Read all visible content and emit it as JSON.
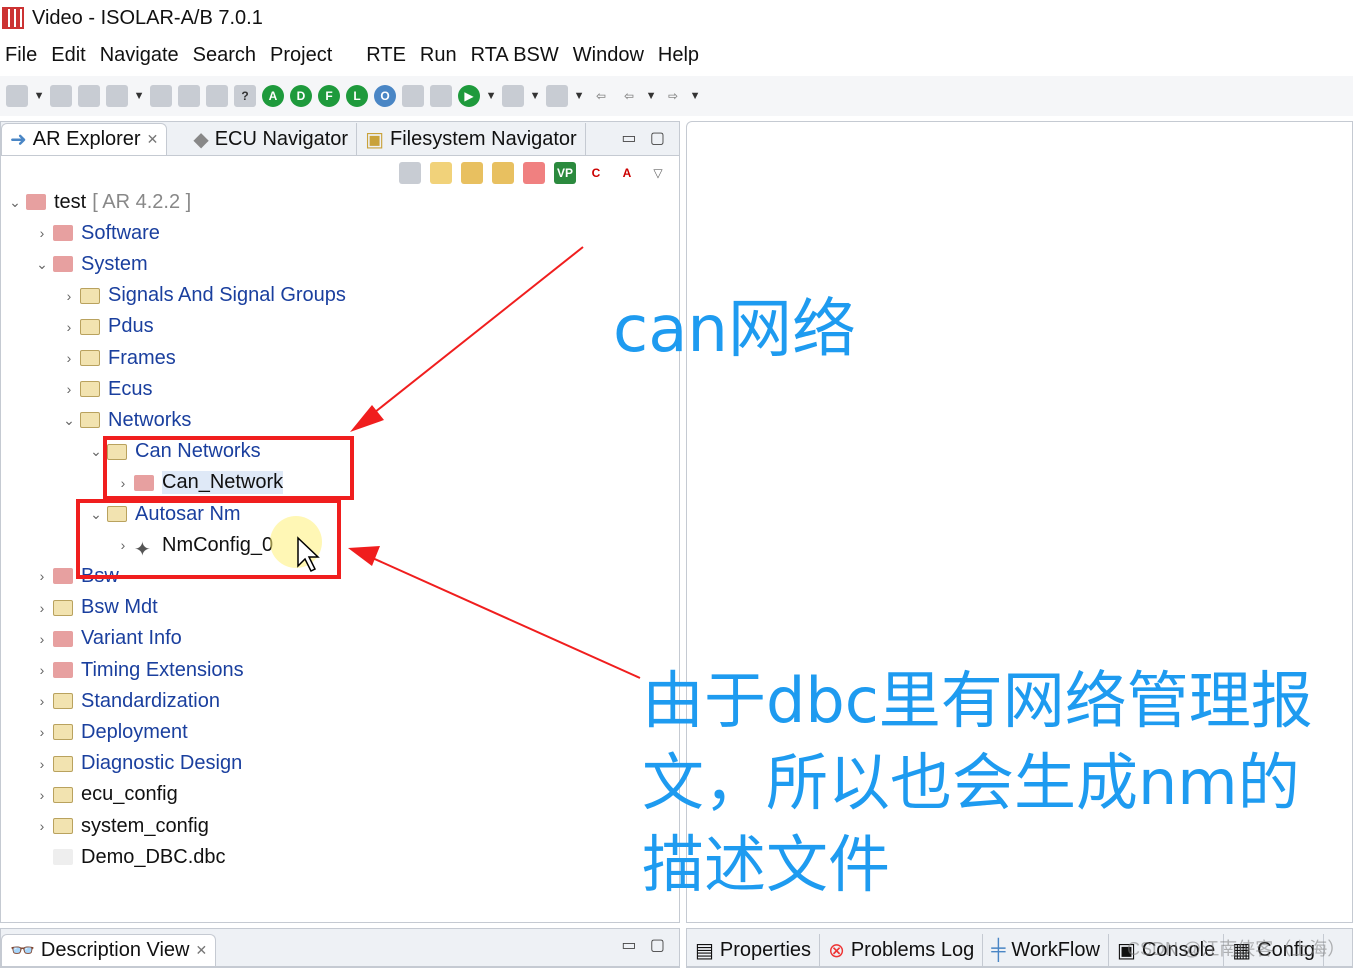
{
  "window": {
    "title": "Video - ISOLAR-A/B 7.0.1"
  },
  "menu": [
    "File",
    "Edit",
    "Navigate",
    "Search",
    "Project",
    "RTE",
    "Run",
    "RTA BSW",
    "Window",
    "Help"
  ],
  "toolbar": {
    "circle_buttons": [
      "A",
      "D",
      "F",
      "L",
      "O"
    ]
  },
  "explorer": {
    "tabs": [
      "AR Explorer",
      "ECU Navigator",
      "Filesystem Navigator"
    ],
    "tree": [
      {
        "label": "test",
        "suffix": "[ AR 4.2.2 ]",
        "level": 0,
        "expanded": true
      },
      {
        "label": "Software",
        "level": 1
      },
      {
        "label": "System",
        "level": 1,
        "expanded": true
      },
      {
        "label": "Signals And Signal Groups",
        "level": 2
      },
      {
        "label": "Pdus",
        "level": 2
      },
      {
        "label": "Frames",
        "level": 2
      },
      {
        "label": "Ecus",
        "level": 2
      },
      {
        "label": "Networks",
        "level": 2,
        "expanded": true
      },
      {
        "label": "Can Networks",
        "level": 3,
        "expanded": true
      },
      {
        "label": "Can_Network",
        "level": 4,
        "selected": true
      },
      {
        "label": "Autosar Nm",
        "level": 3,
        "expanded": true
      },
      {
        "label": "NmConfig_0",
        "level": 4
      },
      {
        "label": "Bsw",
        "level": 1
      },
      {
        "label": "Bsw Mdt",
        "level": 1
      },
      {
        "label": "Variant Info",
        "level": 1
      },
      {
        "label": "Timing Extensions",
        "level": 1
      },
      {
        "label": "Standardization",
        "level": 1
      },
      {
        "label": "Deployment",
        "level": 1
      },
      {
        "label": "Diagnostic Design",
        "level": 1
      },
      {
        "label": "ecu_config",
        "level": 1
      },
      {
        "label": "system_config",
        "level": 1
      },
      {
        "label": "Demo_DBC.dbc",
        "level": 1,
        "leaf": true
      }
    ]
  },
  "bottom_left": {
    "tab": "Description View"
  },
  "bottom_right": {
    "tabs": [
      "Properties",
      "Problems Log",
      "WorkFlow",
      "Console",
      "Config"
    ]
  },
  "annotations": {
    "top": "can网络",
    "bottom": "由于dbc里有网络管理报文，所以也会生成nm的描述文件",
    "watermark": "CSDN @江南侠客（上海）"
  },
  "colors": {
    "annotation": "#1e9bf0",
    "highlight": "#f01e1e"
  }
}
